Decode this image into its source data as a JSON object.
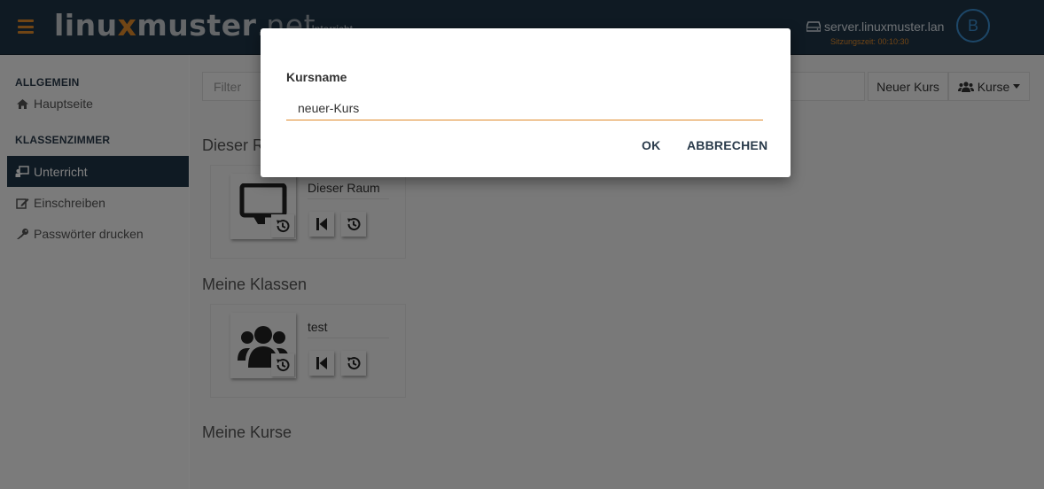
{
  "header": {
    "logo_main": "linu",
    "logo_x": "x",
    "logo_rest": "muster",
    "logo_net": ".net",
    "breadcrumb": "Unterricht",
    "server_name": "server.linuxmuster.lan",
    "session_time": "Sitzungszeit: 00:10:30",
    "avatar_letter": "B"
  },
  "sidebar": {
    "sections": [
      {
        "heading": "ALLGEMEIN",
        "items": [
          {
            "label": "Hauptseite",
            "icon": "home-icon"
          }
        ]
      },
      {
        "heading": "KLASSENZIMMER",
        "items": [
          {
            "label": "Unterricht",
            "icon": "chalkboard-teacher-icon",
            "active": true
          },
          {
            "label": "Einschreiben",
            "icon": "edit-icon"
          },
          {
            "label": "Passwörter drucken",
            "icon": "key-icon"
          }
        ]
      }
    ]
  },
  "toolbar": {
    "filter_placeholder": "Filter",
    "new_course_label": "Neuer Kurs",
    "courses_label": "Kurse"
  },
  "main": {
    "room_section_title": "Dieser Raum",
    "room_card_name": "Dieser Raum",
    "classes_section_title": "Meine Klassen",
    "class_card_name": "test",
    "courses_section_title": "Meine Kurse"
  },
  "modal": {
    "label": "Kursname",
    "input_value": "neuer-Kurs",
    "ok_label": "OK",
    "cancel_label": "ABBRECHEN"
  },
  "colors": {
    "header_bg": "#1f3447",
    "accent": "#e08a2a",
    "avatar_ring": "#3b8fd0"
  }
}
